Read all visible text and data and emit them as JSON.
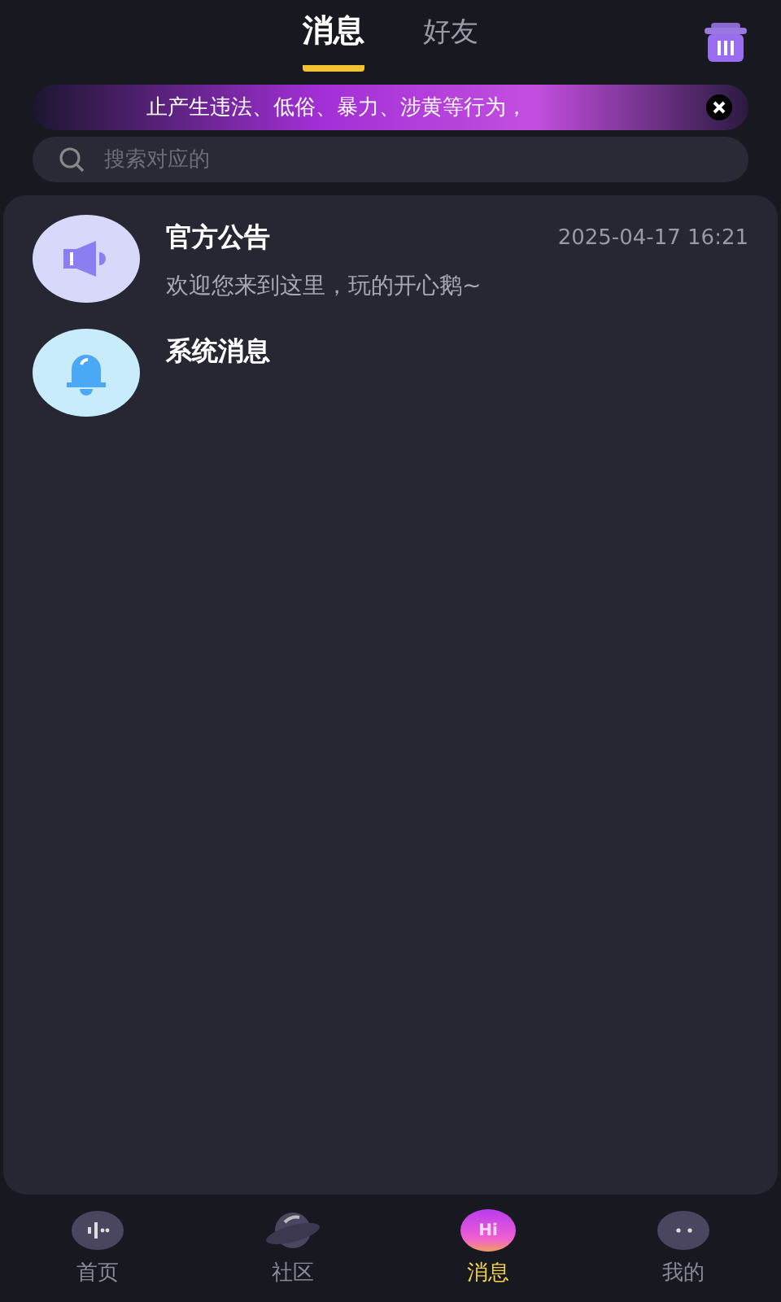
{
  "tabs": [
    {
      "label": "消息",
      "selected": true
    },
    {
      "label": "好友",
      "selected": false
    }
  ],
  "notice": {
    "text": "止产生违法、低俗、暴力、涉黄等行为，"
  },
  "search": {
    "placeholder": "搜索对应的"
  },
  "messages": [
    {
      "kind": "announcement",
      "title": "官方公告",
      "time": "2025-04-17 16:21",
      "preview": "欢迎您来到这里，玩的开心鹅~"
    },
    {
      "kind": "system",
      "title": "系统消息"
    }
  ],
  "nav": [
    {
      "kind": "home",
      "label": "首页",
      "selected": false
    },
    {
      "kind": "community",
      "label": "社区",
      "selected": false
    },
    {
      "kind": "messages",
      "label": "消息",
      "selected": true,
      "badge": "Hi"
    },
    {
      "kind": "profile",
      "label": "我的",
      "selected": false
    }
  ]
}
